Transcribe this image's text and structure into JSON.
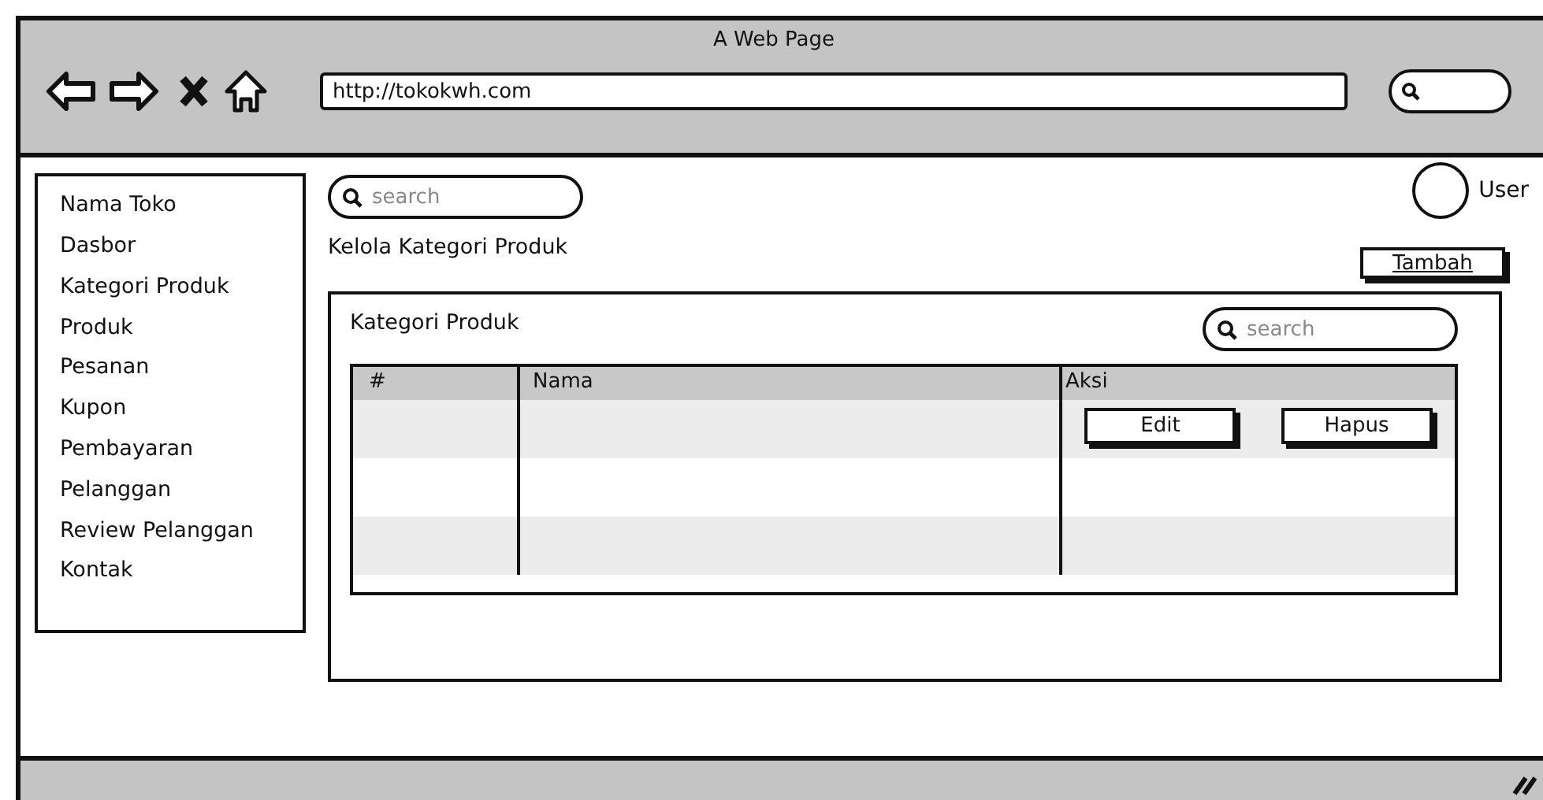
{
  "window": {
    "title": "A Web Page",
    "url": "http://tokokwh.com"
  },
  "sidebar": {
    "title": "Nama Toko",
    "items": [
      {
        "label": "Dasbor"
      },
      {
        "label": "Kategori Produk"
      },
      {
        "label": "Produk"
      },
      {
        "label": "Pesanan"
      },
      {
        "label": "Kupon"
      },
      {
        "label": "Pembayaran"
      },
      {
        "label": "Pelanggan"
      },
      {
        "label": "Review Pelanggan"
      },
      {
        "label": "Kontak"
      }
    ]
  },
  "search": {
    "placeholder": "search"
  },
  "user": {
    "label": "User"
  },
  "heading": "Kelola Kategori Produk",
  "add_button": "Tambah",
  "panel": {
    "title": "Kategori Produk",
    "search": {
      "placeholder": "search"
    },
    "table": {
      "columns": [
        "#",
        "Nama",
        "Aksi"
      ],
      "rows": [
        {
          "actions": [
            "Edit",
            "Hapus"
          ]
        }
      ]
    }
  }
}
